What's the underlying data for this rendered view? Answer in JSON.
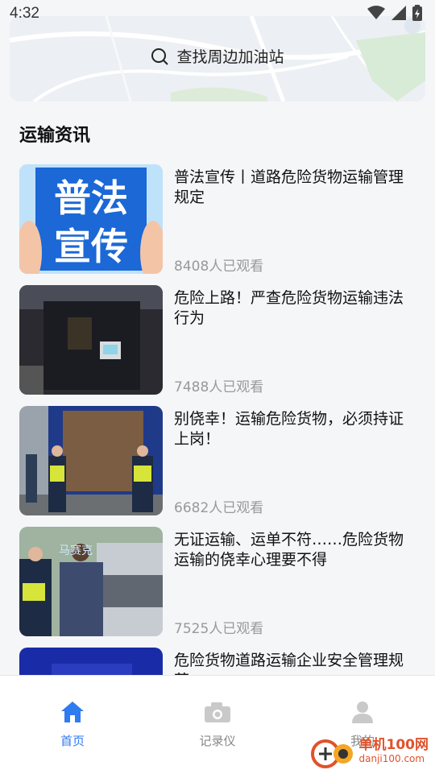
{
  "status_bar": {
    "time": "4:32"
  },
  "search": {
    "label": "查找周边加油站"
  },
  "section": {
    "title": "运输资讯"
  },
  "news": [
    {
      "title": "普法宣传丨道路危险货物运输管理规定",
      "views": "8408人已观看",
      "thumb_text_1": "普法",
      "thumb_text_2": "宣传"
    },
    {
      "title": "危险上路！严查危险货物运输违法行为",
      "views": "7488人已观看"
    },
    {
      "title": "别侥幸！运输危险货物，必须持证上岗！",
      "views": "6682人已观看"
    },
    {
      "title": "无证运输、运单不符……危险货物运输的侥幸心理要不得",
      "views": "7525人已观看",
      "thumb_caption": "马赛克"
    },
    {
      "title": "危险货物道路运输企业安全管理规范",
      "views": ""
    }
  ],
  "tabs": [
    {
      "label": "首页",
      "icon": "home-icon",
      "active": true
    },
    {
      "label": "记录仪",
      "icon": "camera-icon",
      "active": false
    },
    {
      "label": "我的",
      "icon": "user-icon",
      "active": false
    }
  ],
  "watermark": {
    "main": "单机100网",
    "sub": "danji100.com"
  },
  "colors": {
    "active_tab": "#2f7bf0",
    "inactive_tab": "#888888",
    "views": "#999999"
  }
}
